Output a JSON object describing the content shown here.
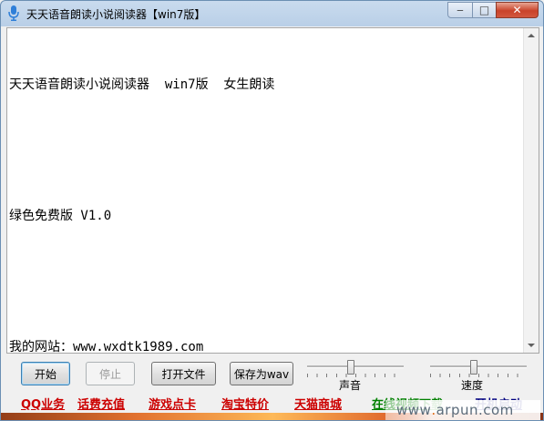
{
  "window": {
    "title": "天天语音朗读小说阅读器【win7版】"
  },
  "controls": {
    "minimize_glyph": "‒",
    "maximize_glyph": "□",
    "close_glyph": "✕"
  },
  "editor": {
    "lines": [
      "天天语音朗读小说阅读器  win7版  女生朗读",
      "",
      "绿色免费版 V1.0",
      "",
      "我的网站：www.wxdtk1989.com"
    ]
  },
  "buttons": {
    "start": "开始",
    "stop": "停止",
    "open_file": "打开文件",
    "save_wav": "保存为wav"
  },
  "sliders": {
    "volume": {
      "label": "声音",
      "value": 0.45
    },
    "speed": {
      "label": "速度",
      "value": 0.45
    }
  },
  "links": [
    {
      "label": "QQ业务",
      "color": "#cc0000"
    },
    {
      "label": "话费充值",
      "color": "#cc0000"
    },
    {
      "label": "游戏点卡",
      "color": "#cc0000"
    },
    {
      "label": "淘宝特价",
      "color": "#cc0000"
    },
    {
      "label": "天猫商城",
      "color": "#cc0000"
    },
    {
      "label": "在线视频下载",
      "color": "#008000"
    },
    {
      "label": "开机启动",
      "color": "#000080"
    }
  ],
  "watermark": {
    "prefix": "www",
    "dot": ".",
    "domain": "arpun.com"
  }
}
